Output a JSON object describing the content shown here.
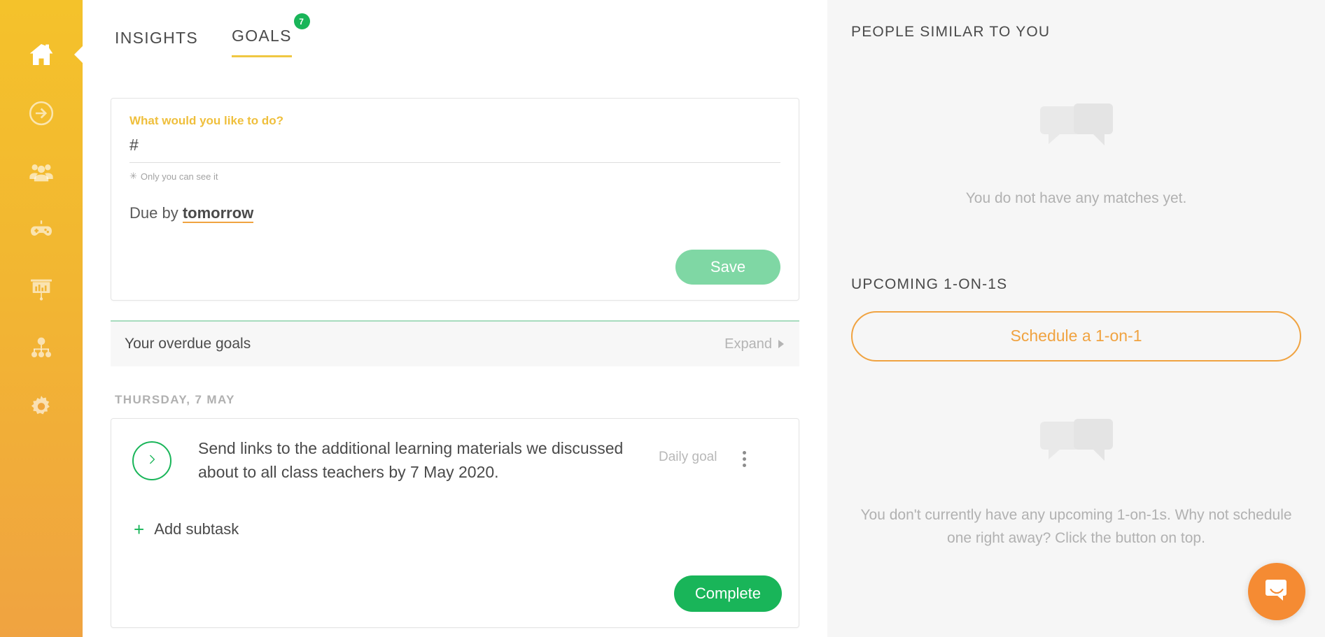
{
  "sidebar": {
    "items": [
      {
        "icon": "home-icon",
        "name": "sidebar-item-home",
        "active": true
      },
      {
        "icon": "arrow-circle-icon",
        "name": "sidebar-item-checkin",
        "active": false
      },
      {
        "icon": "people-icon",
        "name": "sidebar-item-team",
        "active": false
      },
      {
        "icon": "gamepad-icon",
        "name": "sidebar-item-games",
        "active": false
      },
      {
        "icon": "presentation-chart-icon",
        "name": "sidebar-item-reports",
        "active": false
      },
      {
        "icon": "org-chart-icon",
        "name": "sidebar-item-orgchart",
        "active": false
      },
      {
        "icon": "gear-icon",
        "name": "sidebar-item-settings",
        "active": false
      }
    ]
  },
  "tabs": [
    {
      "label": "INSIGHTS",
      "active": false,
      "badge": ""
    },
    {
      "label": "GOALS",
      "active": true,
      "badge": "7"
    }
  ],
  "new_goal": {
    "label": "What would you like to do?",
    "input_value": "#",
    "input_placeholder": "",
    "privacy_hint": "Only you can see it",
    "privacy_marker": "✳",
    "due_prefix": "Due by",
    "due_value": "tomorrow",
    "save_label": "Save"
  },
  "overdue": {
    "title": "Your overdue goals",
    "expand_label": "Expand"
  },
  "day_heading": "THURSDAY, 7 MAY",
  "goal": {
    "text": "Send links to the additional learning materials we discussed about to all class teachers by 7 May 2020.",
    "type_label": "Daily goal",
    "add_subtask_label": "Add subtask",
    "add_subtask_plus": "+",
    "complete_label": "Complete"
  },
  "right_panel": {
    "people_title": "PEOPLE SIMILAR TO YOU",
    "people_empty": "You do not have any matches yet.",
    "oneonone_title": "UPCOMING 1-ON-1S",
    "schedule_label": "Schedule a 1-on-1",
    "oneonone_empty": "You don't currently have any upcoming 1-on-1s. Why not schedule one right away? Click the button on top."
  },
  "colors": {
    "sidebar_top": "#F4C22B",
    "sidebar_bottom": "#F0A341",
    "accent_yellow": "#EFC742",
    "accent_orange": "#F0A341",
    "green": "#19B559",
    "green_light": "#7FD7A4",
    "panel_bg": "#F6F6F6",
    "intercom": "#F58B33"
  }
}
